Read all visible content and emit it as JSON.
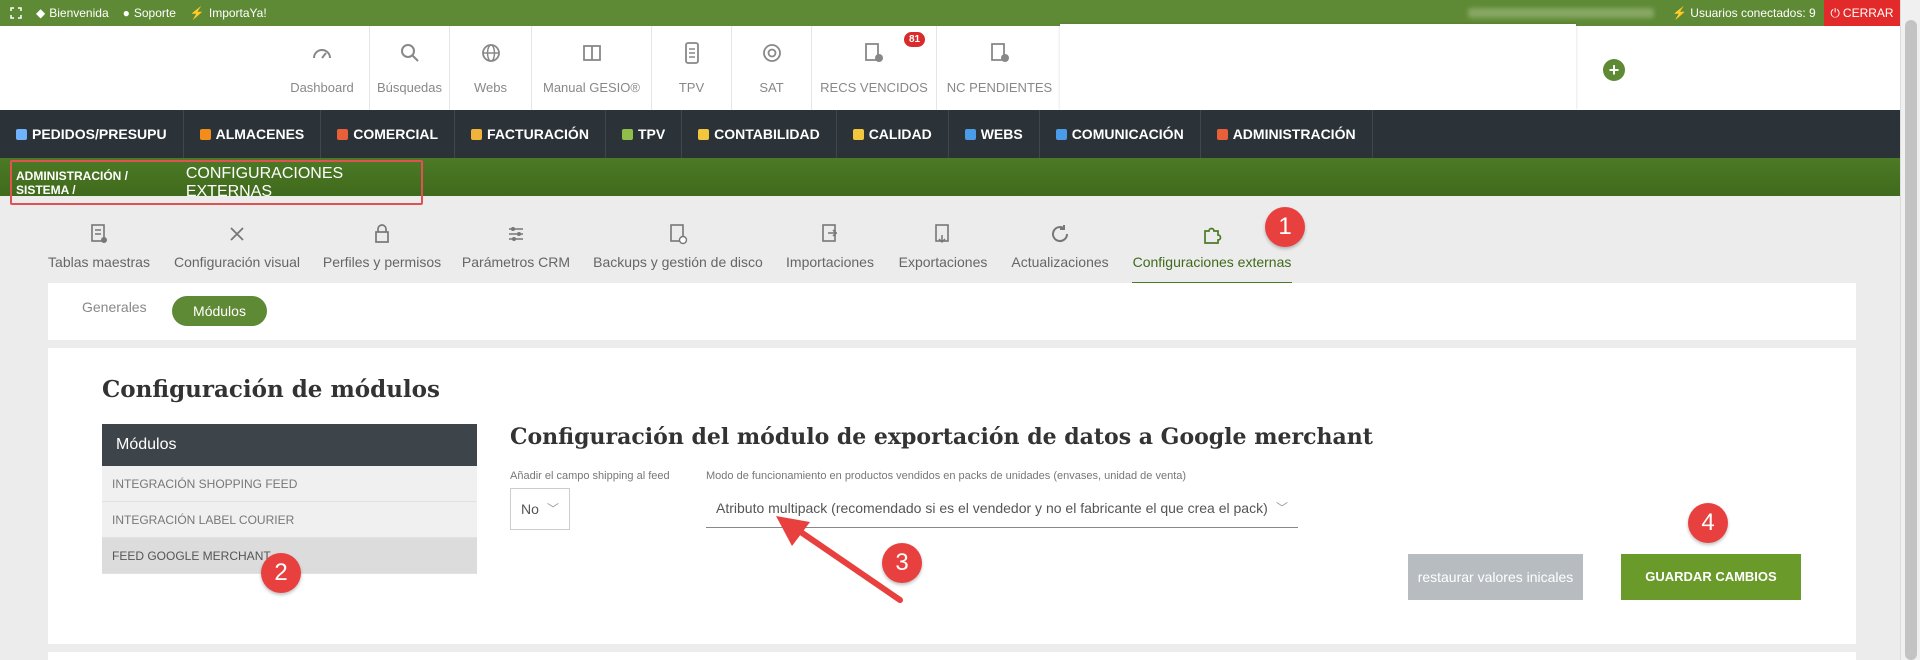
{
  "topbar": {
    "links": [
      "Bienvenida",
      "Soporte",
      "ImportaYa!"
    ],
    "users_connected": "Usuarios conectados: 9",
    "close_label": "CERRAR"
  },
  "quickbar": {
    "items": [
      {
        "label": "Dashboard",
        "icon": "speedometer-icon"
      },
      {
        "label": "Búsquedas",
        "icon": "search-icon"
      },
      {
        "label": "Webs",
        "icon": "globe-icon"
      },
      {
        "label": "Manual GESIO®",
        "icon": "book-icon"
      },
      {
        "label": "TPV",
        "icon": "pos-terminal-icon"
      },
      {
        "label": "SAT",
        "icon": "lifebuoy-icon"
      },
      {
        "label": "RECS VENCIDOS",
        "icon": "receipt-icon",
        "badge": "81"
      },
      {
        "label": "NC PENDIENTES",
        "icon": "receipt-icon"
      }
    ],
    "plus_label": "+"
  },
  "mainnav": {
    "items": [
      {
        "label": "PEDIDOS/PRESUPU",
        "color": "#6fb3ff"
      },
      {
        "label": "ALMACENES",
        "color": "#f28c1a"
      },
      {
        "label": "COMERCIAL",
        "color": "#e8603a"
      },
      {
        "label": "FACTURACIÓN",
        "color": "#f2b33d"
      },
      {
        "label": "TPV",
        "color": "#8fbf4a"
      },
      {
        "label": "CONTABILIDAD",
        "color": "#f2c63d"
      },
      {
        "label": "CALIDAD",
        "color": "#f2c63d"
      },
      {
        "label": "WEBS",
        "color": "#4a9be8"
      },
      {
        "label": "COMUNICACIÓN",
        "color": "#4a9be8"
      },
      {
        "label": "ADMINISTRACIÓN",
        "color": "#e8603a"
      }
    ]
  },
  "breadcrumb": {
    "path": "ADMINISTRACIÓN / SISTEMA /",
    "current": "CONFIGURACIONES EXTERNAS"
  },
  "sectabs": [
    {
      "label": "Tablas maestras",
      "icon": "table-gear-icon"
    },
    {
      "label": "Configuración visual",
      "icon": "tools-icon"
    },
    {
      "label": "Perfiles y permisos",
      "icon": "lock-icon"
    },
    {
      "label": "Parámetros CRM",
      "icon": "sliders-icon"
    },
    {
      "label": "Backups y gestión de disco",
      "icon": "document-clock-icon"
    },
    {
      "label": "Importaciones",
      "icon": "import-icon"
    },
    {
      "label": "Exportaciones",
      "icon": "export-icon"
    },
    {
      "label": "Actualizaciones",
      "icon": "refresh-icon"
    },
    {
      "label": "Configuraciones externas",
      "icon": "puzzle-icon",
      "active": true
    }
  ],
  "subtabs": {
    "generales": "Generales",
    "modulos": "Módulos"
  },
  "config": {
    "title": "Configuración de módulos",
    "list_header": "Módulos",
    "modules": [
      "INTEGRACIÓN SHOPPING FEED",
      "INTEGRACIÓN LABEL COURIER",
      "FEED GOOGLE MERCHANT"
    ],
    "detail_title": "Configuración del módulo de exportación de datos a Google merchant",
    "shipping_label": "Añadir el campo shipping al feed",
    "shipping_value": "No",
    "mode_label": "Modo de funcionamiento en productos vendidos en packs de unidades (envases, unidad de venta)",
    "mode_value": "Atributo multipack (recomendado si es el vendedor y no el fabricante el que crea el pack)",
    "reset_label": "restaurar valores inicales",
    "save_label": "GUARDAR CAMBIOS"
  },
  "markers": [
    "1",
    "2",
    "3",
    "4"
  ],
  "colors": {
    "brand_green": "#5f8a35",
    "nav_dark": "#2b3338",
    "close_red": "#e32a2a",
    "marker_red": "#e8403e"
  }
}
